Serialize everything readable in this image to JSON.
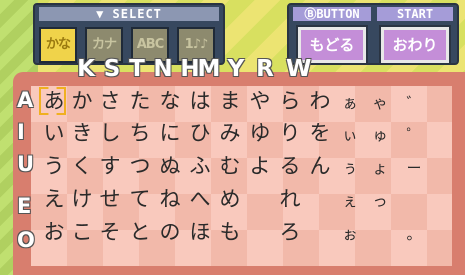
{
  "select_panel": {
    "header": "▼ SELECT",
    "modes": [
      {
        "label": "かな",
        "active": true
      },
      {
        "label": "カナ",
        "active": false
      },
      {
        "label": "ABC",
        "active": false
      },
      {
        "label": "1♪♪",
        "active": false
      }
    ]
  },
  "button_panel": {
    "b_header": "ⒷBUTTON",
    "start_header": "START",
    "back_label": "もどる",
    "end_label": "おわり"
  },
  "consonants": [
    "K",
    "S",
    "T",
    "N",
    "H",
    "M",
    "Y",
    "R",
    "W"
  ],
  "vowels": [
    "A",
    "I",
    "U",
    "E",
    "O"
  ],
  "grid": [
    [
      "あ",
      "か",
      "さ",
      "た",
      "な",
      "は",
      "ま",
      "や",
      "ら",
      "わ",
      "ぁ",
      "ゃ",
      "゛"
    ],
    [
      "い",
      "き",
      "し",
      "ち",
      "に",
      "ひ",
      "み",
      "ゆ",
      "り",
      "を",
      "ぃ",
      "ゅ",
      "゜"
    ],
    [
      "う",
      "く",
      "す",
      "つ",
      "ぬ",
      "ふ",
      "む",
      "よ",
      "る",
      "ん",
      "ぅ",
      "ょ",
      "ー"
    ],
    [
      "え",
      "け",
      "せ",
      "て",
      "ね",
      "へ",
      "め",
      "",
      "れ",
      "",
      "ぇ",
      "っ",
      ""
    ],
    [
      "お",
      "こ",
      "そ",
      "と",
      "の",
      "ほ",
      "も",
      "",
      "ろ",
      "",
      "ぉ",
      "",
      "。"
    ]
  ],
  "colors": {
    "active_mode": "#f0d34a",
    "action_button": "#c48ed8",
    "board": "#d87e6e"
  }
}
